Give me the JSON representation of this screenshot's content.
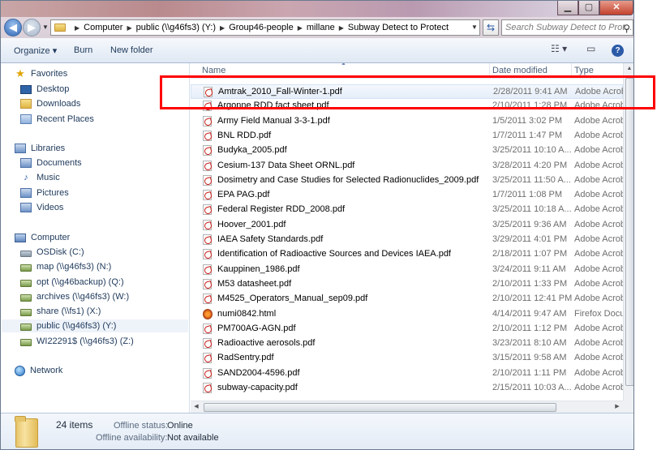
{
  "address": {
    "segments": [
      "Computer",
      "public (\\\\g46fs3) (Y:)",
      "Group46-people",
      "millane",
      "Subway Detect to Protect"
    ]
  },
  "search": {
    "placeholder": "Search Subway Detect to Prot..."
  },
  "toolbar": {
    "organize": "Organize ▾",
    "burn": "Burn",
    "new_folder": "New folder"
  },
  "columns": {
    "name": "Name",
    "date": "Date modified",
    "type": "Type"
  },
  "sidebar": {
    "favorites": "Favorites",
    "fav_items": [
      "Desktop",
      "Downloads",
      "Recent Places"
    ],
    "libraries": "Libraries",
    "lib_items": [
      "Documents",
      "Music",
      "Pictures",
      "Videos"
    ],
    "computer": "Computer",
    "drives": [
      "OSDisk (C:)",
      "map (\\\\g46fs3) (N:)",
      "opt (\\\\g46backup) (Q:)",
      "archives (\\\\g46fs3) (W:)",
      "share (\\\\fs1) (X:)",
      "public (\\\\g46fs3) (Y:)",
      "WI22291$ (\\\\g46fs3) (Z:)"
    ],
    "network": "Network"
  },
  "files": [
    {
      "name": "Amtrak_2010_Fall-Winter-1.pdf",
      "date": "2/28/2011 9:41 AM",
      "type": "Adobe Acrob"
    },
    {
      "name": "Argonne RDD fact sheet.pdf",
      "date": "2/10/2011 1:28 PM",
      "type": "Adobe Acrob"
    },
    {
      "name": "Army Field Manual 3-3-1.pdf",
      "date": "1/5/2011 3:02 PM",
      "type": "Adobe Acrob"
    },
    {
      "name": "BNL RDD.pdf",
      "date": "1/7/2011 1:47 PM",
      "type": "Adobe Acrob"
    },
    {
      "name": "Budyka_2005.pdf",
      "date": "3/25/2011 10:10 A...",
      "type": "Adobe Acrob"
    },
    {
      "name": "Cesium-137 Data Sheet ORNL.pdf",
      "date": "3/28/2011 4:20 PM",
      "type": "Adobe Acrob"
    },
    {
      "name": "Dosimetry and Case Studies for Selected Radionuclides_2009.pdf",
      "date": "3/25/2011 11:50 A...",
      "type": "Adobe Acrob"
    },
    {
      "name": "EPA PAG.pdf",
      "date": "1/7/2011 1:08 PM",
      "type": "Adobe Acrob"
    },
    {
      "name": "Federal Register RDD_2008.pdf",
      "date": "3/25/2011 10:18 A...",
      "type": "Adobe Acrob"
    },
    {
      "name": "Hoover_2001.pdf",
      "date": "3/25/2011 9:36 AM",
      "type": "Adobe Acrob"
    },
    {
      "name": "IAEA Safety Standards.pdf",
      "date": "3/29/2011 4:01 PM",
      "type": "Adobe Acrob"
    },
    {
      "name": "Identification of Radioactive Sources and Devices IAEA.pdf",
      "date": "2/18/2011 1:07 PM",
      "type": "Adobe Acrob"
    },
    {
      "name": "Kauppinen_1986.pdf",
      "date": "3/24/2011 9:11 AM",
      "type": "Adobe Acrob"
    },
    {
      "name": "M53 datasheet.pdf",
      "date": "2/10/2011 1:33 PM",
      "type": "Adobe Acrob"
    },
    {
      "name": "M4525_Operators_Manual_sep09.pdf",
      "date": "2/10/2011 12:41 PM",
      "type": "Adobe Acrob"
    },
    {
      "name": "numi0842.html",
      "date": "4/14/2011 9:47 AM",
      "type": "Firefox Docu"
    },
    {
      "name": "PM700AG-AGN.pdf",
      "date": "2/10/2011 1:12 PM",
      "type": "Adobe Acrob"
    },
    {
      "name": "Radioactive aerosols.pdf",
      "date": "3/23/2011 8:10 AM",
      "type": "Adobe Acrob"
    },
    {
      "name": "RadSentry.pdf",
      "date": "3/15/2011 9:58 AM",
      "type": "Adobe Acrob"
    },
    {
      "name": "SAND2004-4596.pdf",
      "date": "2/10/2011 1:11 PM",
      "type": "Adobe Acrob"
    },
    {
      "name": "subway-capacity.pdf",
      "date": "2/15/2011 10:03 A...",
      "type": "Adobe Acrob"
    }
  ],
  "details": {
    "count": "24 items",
    "offline_status_label": "Offline status:",
    "offline_status_value": "Online",
    "offline_avail_label": "Offline availability:",
    "offline_avail_value": "Not available"
  },
  "colors": {
    "highlight": "#ff0000",
    "accent": "#1e395b"
  }
}
